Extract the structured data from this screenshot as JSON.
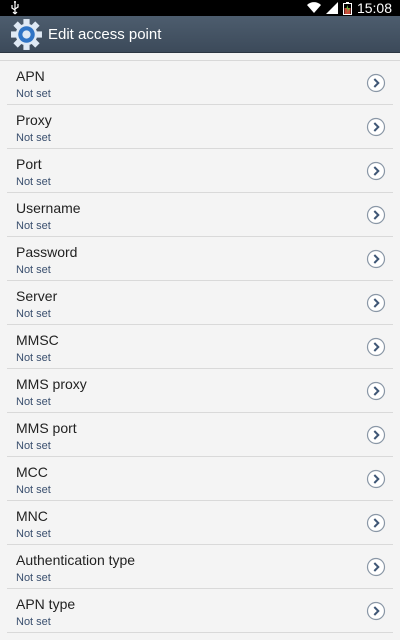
{
  "status_bar": {
    "time": "15:08",
    "icons": [
      "usb-icon",
      "wifi-icon",
      "signal-icon",
      "battery-icon"
    ]
  },
  "action_bar": {
    "title": "Edit access point",
    "icon": "settings-gear-icon"
  },
  "settings": [
    {
      "label": "APN",
      "value": "Not set"
    },
    {
      "label": "Proxy",
      "value": "Not set"
    },
    {
      "label": "Port",
      "value": "Not set"
    },
    {
      "label": "Username",
      "value": "Not set"
    },
    {
      "label": "Password",
      "value": "Not set"
    },
    {
      "label": "Server",
      "value": "Not set"
    },
    {
      "label": "MMSC",
      "value": "Not set"
    },
    {
      "label": "MMS proxy",
      "value": "Not set"
    },
    {
      "label": "MMS port",
      "value": "Not set"
    },
    {
      "label": "MCC",
      "value": "Not set"
    },
    {
      "label": "MNC",
      "value": "Not set"
    },
    {
      "label": "Authentication type",
      "value": "Not set"
    },
    {
      "label": "APN type",
      "value": "Not set"
    }
  ],
  "colors": {
    "action_bar": "#45535f",
    "value_text": "#3a4f6e",
    "background": "#f4f4f4"
  }
}
